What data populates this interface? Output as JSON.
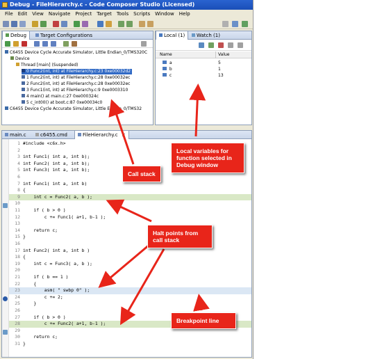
{
  "window": {
    "title": "Debug - FileHierarchy.c - Code Composer Studio (Licensed)"
  },
  "menu": [
    "File",
    "Edit",
    "View",
    "Navigate",
    "Project",
    "Target",
    "Tools",
    "Scripts",
    "Window",
    "Help"
  ],
  "debug_view": {
    "tabs": [
      "Debug",
      "Target Configurations"
    ],
    "tree": [
      "C6455 Device Cycle Accurate Simulator, Little Endian_0/TMS320C",
      "Device",
      "Thread [main] (Suspended)",
      "0 Func2(int, int) at FileHierarchy.c:23 0xe00032d2",
      "1 Func2(int, int) at FileHierarchy.c:28 0xe00032ec",
      "2 Func2(int, int) at FileHierarchy.c:28 0xe00032ec",
      "3 Func1(int, int) at FileHierarchy.c:9 0xe0003310",
      "4 main() at main.c:27 0xe000324c",
      "5 c_int00() at boot.c:87 0xe00034c0",
      "C6455 Device Cycle Accurate Simulator, Little Endian_0/TMS32"
    ]
  },
  "locals_view": {
    "tabs": [
      "Local (1)",
      "Watch (1)"
    ],
    "columns": [
      "Name",
      "Value"
    ],
    "rows": [
      {
        "name": "a",
        "value": "5"
      },
      {
        "name": "b",
        "value": "1"
      },
      {
        "name": "c",
        "value": "13"
      }
    ]
  },
  "editor": {
    "tabs": [
      "main.c",
      "c6455.cmd",
      "FileHierarchy.c"
    ],
    "lines": [
      {
        "n": "1",
        "t": "#include <c6x.h>"
      },
      {
        "n": "2",
        "t": ""
      },
      {
        "n": "3",
        "t": "int Func1( int a, int b);"
      },
      {
        "n": "4",
        "t": "int Func2( int a, int b);"
      },
      {
        "n": "5",
        "t": "int Func3( int a, int b);"
      },
      {
        "n": "6",
        "t": ""
      },
      {
        "n": "7",
        "t": "int Func1( int a, int b)"
      },
      {
        "n": "8",
        "t": "{"
      },
      {
        "n": "9",
        "t": "    int c = Func2( a, b );"
      },
      {
        "n": "10",
        "t": ""
      },
      {
        "n": "11",
        "t": "    if ( b > 0 )"
      },
      {
        "n": "12",
        "t": "        c += Func1( a+1, b-1 );"
      },
      {
        "n": "13",
        "t": ""
      },
      {
        "n": "14",
        "t": "    return c;"
      },
      {
        "n": "15",
        "t": "}"
      },
      {
        "n": "16",
        "t": ""
      },
      {
        "n": "17",
        "t": "int Func2( int a, int b )"
      },
      {
        "n": "18",
        "t": "{"
      },
      {
        "n": "19",
        "t": "    int c = Func3( a, b );"
      },
      {
        "n": "20",
        "t": ""
      },
      {
        "n": "21",
        "t": "    if ( b == 1 )"
      },
      {
        "n": "22",
        "t": "    {"
      },
      {
        "n": "23",
        "t": "        asm( \" swbp 0\" );"
      },
      {
        "n": "24",
        "t": "        c += 2;"
      },
      {
        "n": "25",
        "t": "    }"
      },
      {
        "n": "26",
        "t": ""
      },
      {
        "n": "27",
        "t": "    if ( b > 0 )"
      },
      {
        "n": "28",
        "t": "        c += Func2( a+1, b-1 );"
      },
      {
        "n": "29",
        "t": ""
      },
      {
        "n": "30",
        "t": "    return c;"
      },
      {
        "n": "31",
        "t": "}"
      }
    ]
  },
  "callouts": {
    "local_vars": "Local variables for function selected in Debug window",
    "call_stack": "Call stack",
    "halt_points": "Halt points from call stack",
    "breakpoint": "Breakpoint line"
  },
  "colors": {
    "callout": "#e8251a",
    "selection": "#316ac5",
    "halt_highlight": "#d9e8c6"
  }
}
